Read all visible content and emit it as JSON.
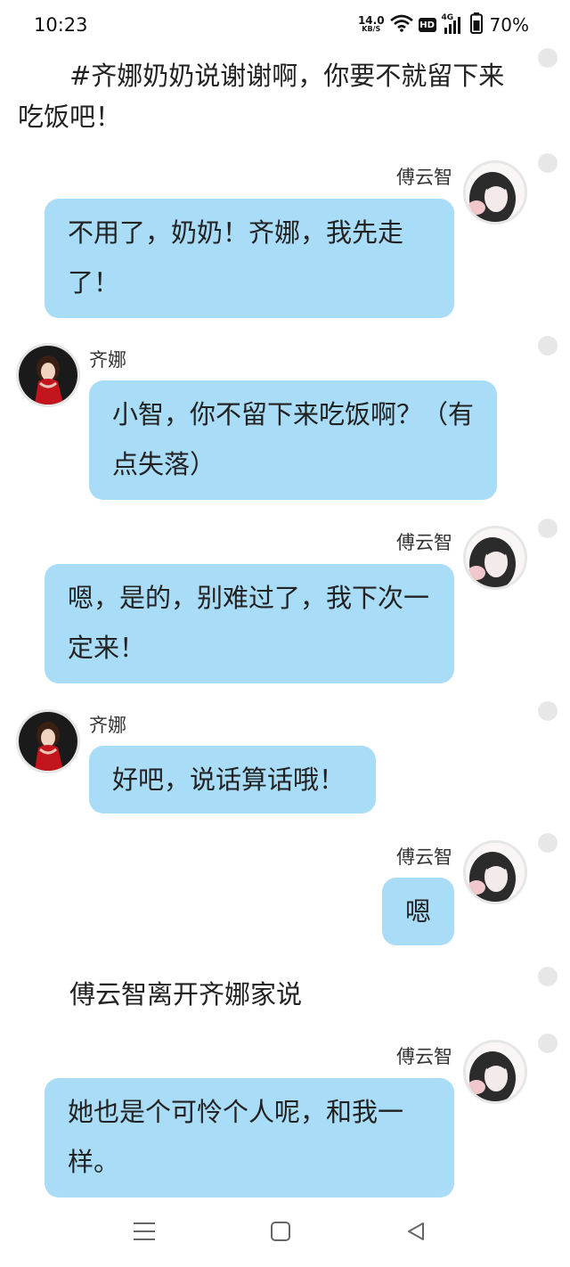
{
  "status_bar": {
    "time": "10:23",
    "net_speed_value": "14.0",
    "net_speed_unit": "KB/S",
    "hd_badge": "HD",
    "signal_label": "4G",
    "battery_percent": "70%"
  },
  "chat": {
    "narration_1": "#齐娜奶奶说谢谢啊，你要不就留下来吃饭吧！",
    "narration_2": "傅云智离开齐娜家说",
    "messages": [
      {
        "sender": "傅云智",
        "text": "不用了，奶奶！齐娜，我先走了！"
      },
      {
        "sender": "齐娜",
        "text": "小智，你不留下来吃饭啊？（有点失落）"
      },
      {
        "sender": "傅云智",
        "text": "嗯，是的，别难过了，我下次一定来！"
      },
      {
        "sender": "齐娜",
        "text": "好吧，说话算话哦！"
      },
      {
        "sender": "傅云智",
        "text": "嗯"
      },
      {
        "sender": "傅云智",
        "text": "她也是个可怜个人呢，和我一样。"
      }
    ]
  },
  "colors": {
    "bubble": "#a9dcf7",
    "background": "#ffffff",
    "dot": "#e7e7e7"
  },
  "icons": {
    "nav": [
      "menu-icon",
      "home-square-icon",
      "back-triangle-icon"
    ]
  }
}
